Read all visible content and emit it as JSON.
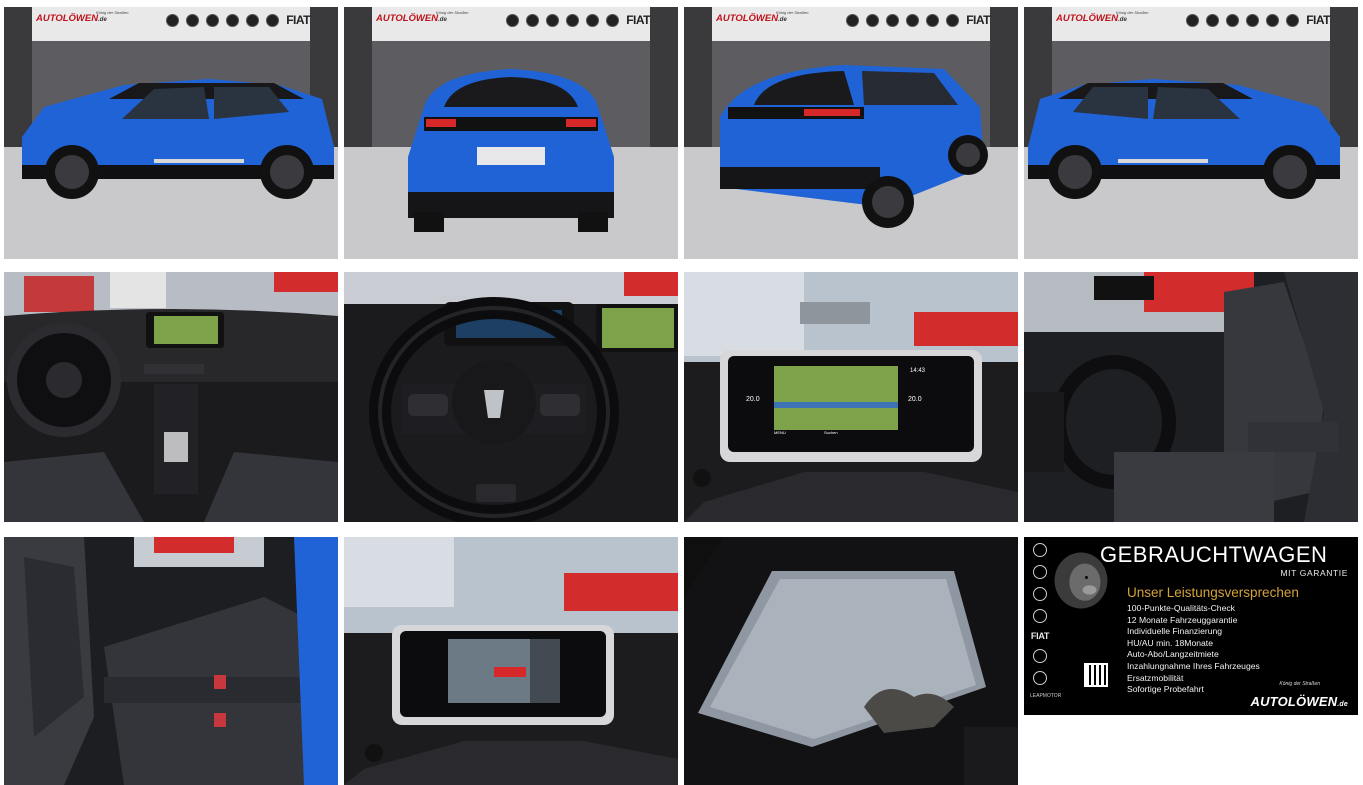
{
  "gallery": {
    "photos": [
      {
        "label": "Exterior side view left",
        "kind": "exterior"
      },
      {
        "label": "Exterior rear view",
        "kind": "exterior"
      },
      {
        "label": "Exterior rear three-quarter view",
        "kind": "exterior"
      },
      {
        "label": "Exterior side view right",
        "kind": "exterior"
      },
      {
        "label": "Dashboard overview",
        "kind": "interior"
      },
      {
        "label": "Steering wheel and instrument cluster",
        "kind": "interior"
      },
      {
        "label": "Navigation touchscreen",
        "kind": "interior"
      },
      {
        "label": "Front seats",
        "kind": "interior"
      },
      {
        "label": "Rear seats",
        "kind": "interior"
      },
      {
        "label": "Rear camera display",
        "kind": "interior"
      },
      {
        "label": "Panoramic glass roof",
        "kind": "interior"
      }
    ]
  },
  "dealer_header": {
    "logo_text": "AUTOLÖWEN",
    "logo_suffix": ".de",
    "slogan": "König der Straßen",
    "fiat": "FIAT"
  },
  "promo": {
    "title": "GEBRAUCHTWAGEN",
    "subtitle": "MIT GARANTIE",
    "heading": "Unser Leistungsversprechen",
    "items": [
      "100-Punkte-Qualitäts-Check",
      "12 Monate Fahrzeuggarantie",
      "Individuelle Finanzierung",
      "HU/AU min. 18Monate",
      "Auto-Abo/Langzeitmiete",
      "Inzahlungnahme Ihres Fahrzeuges",
      "Ersatzmobilität",
      "Sofortige Probefahrt"
    ],
    "brand_fiat": "FIAT",
    "brand_leapmotor": "LEAPMOTOR",
    "logo_slogan": "König der Straßen",
    "logo_text": "AUTOLÖWEN",
    "logo_suffix": ".de"
  },
  "screen": {
    "time": "14:43",
    "temp_left": "20.0",
    "temp_right": "20.0",
    "menu": "MENU",
    "search": "Suchen"
  },
  "colors": {
    "car_blue": "#1f63d6",
    "dealer_red": "#c0121b",
    "promo_gold": "#d4a23a"
  }
}
